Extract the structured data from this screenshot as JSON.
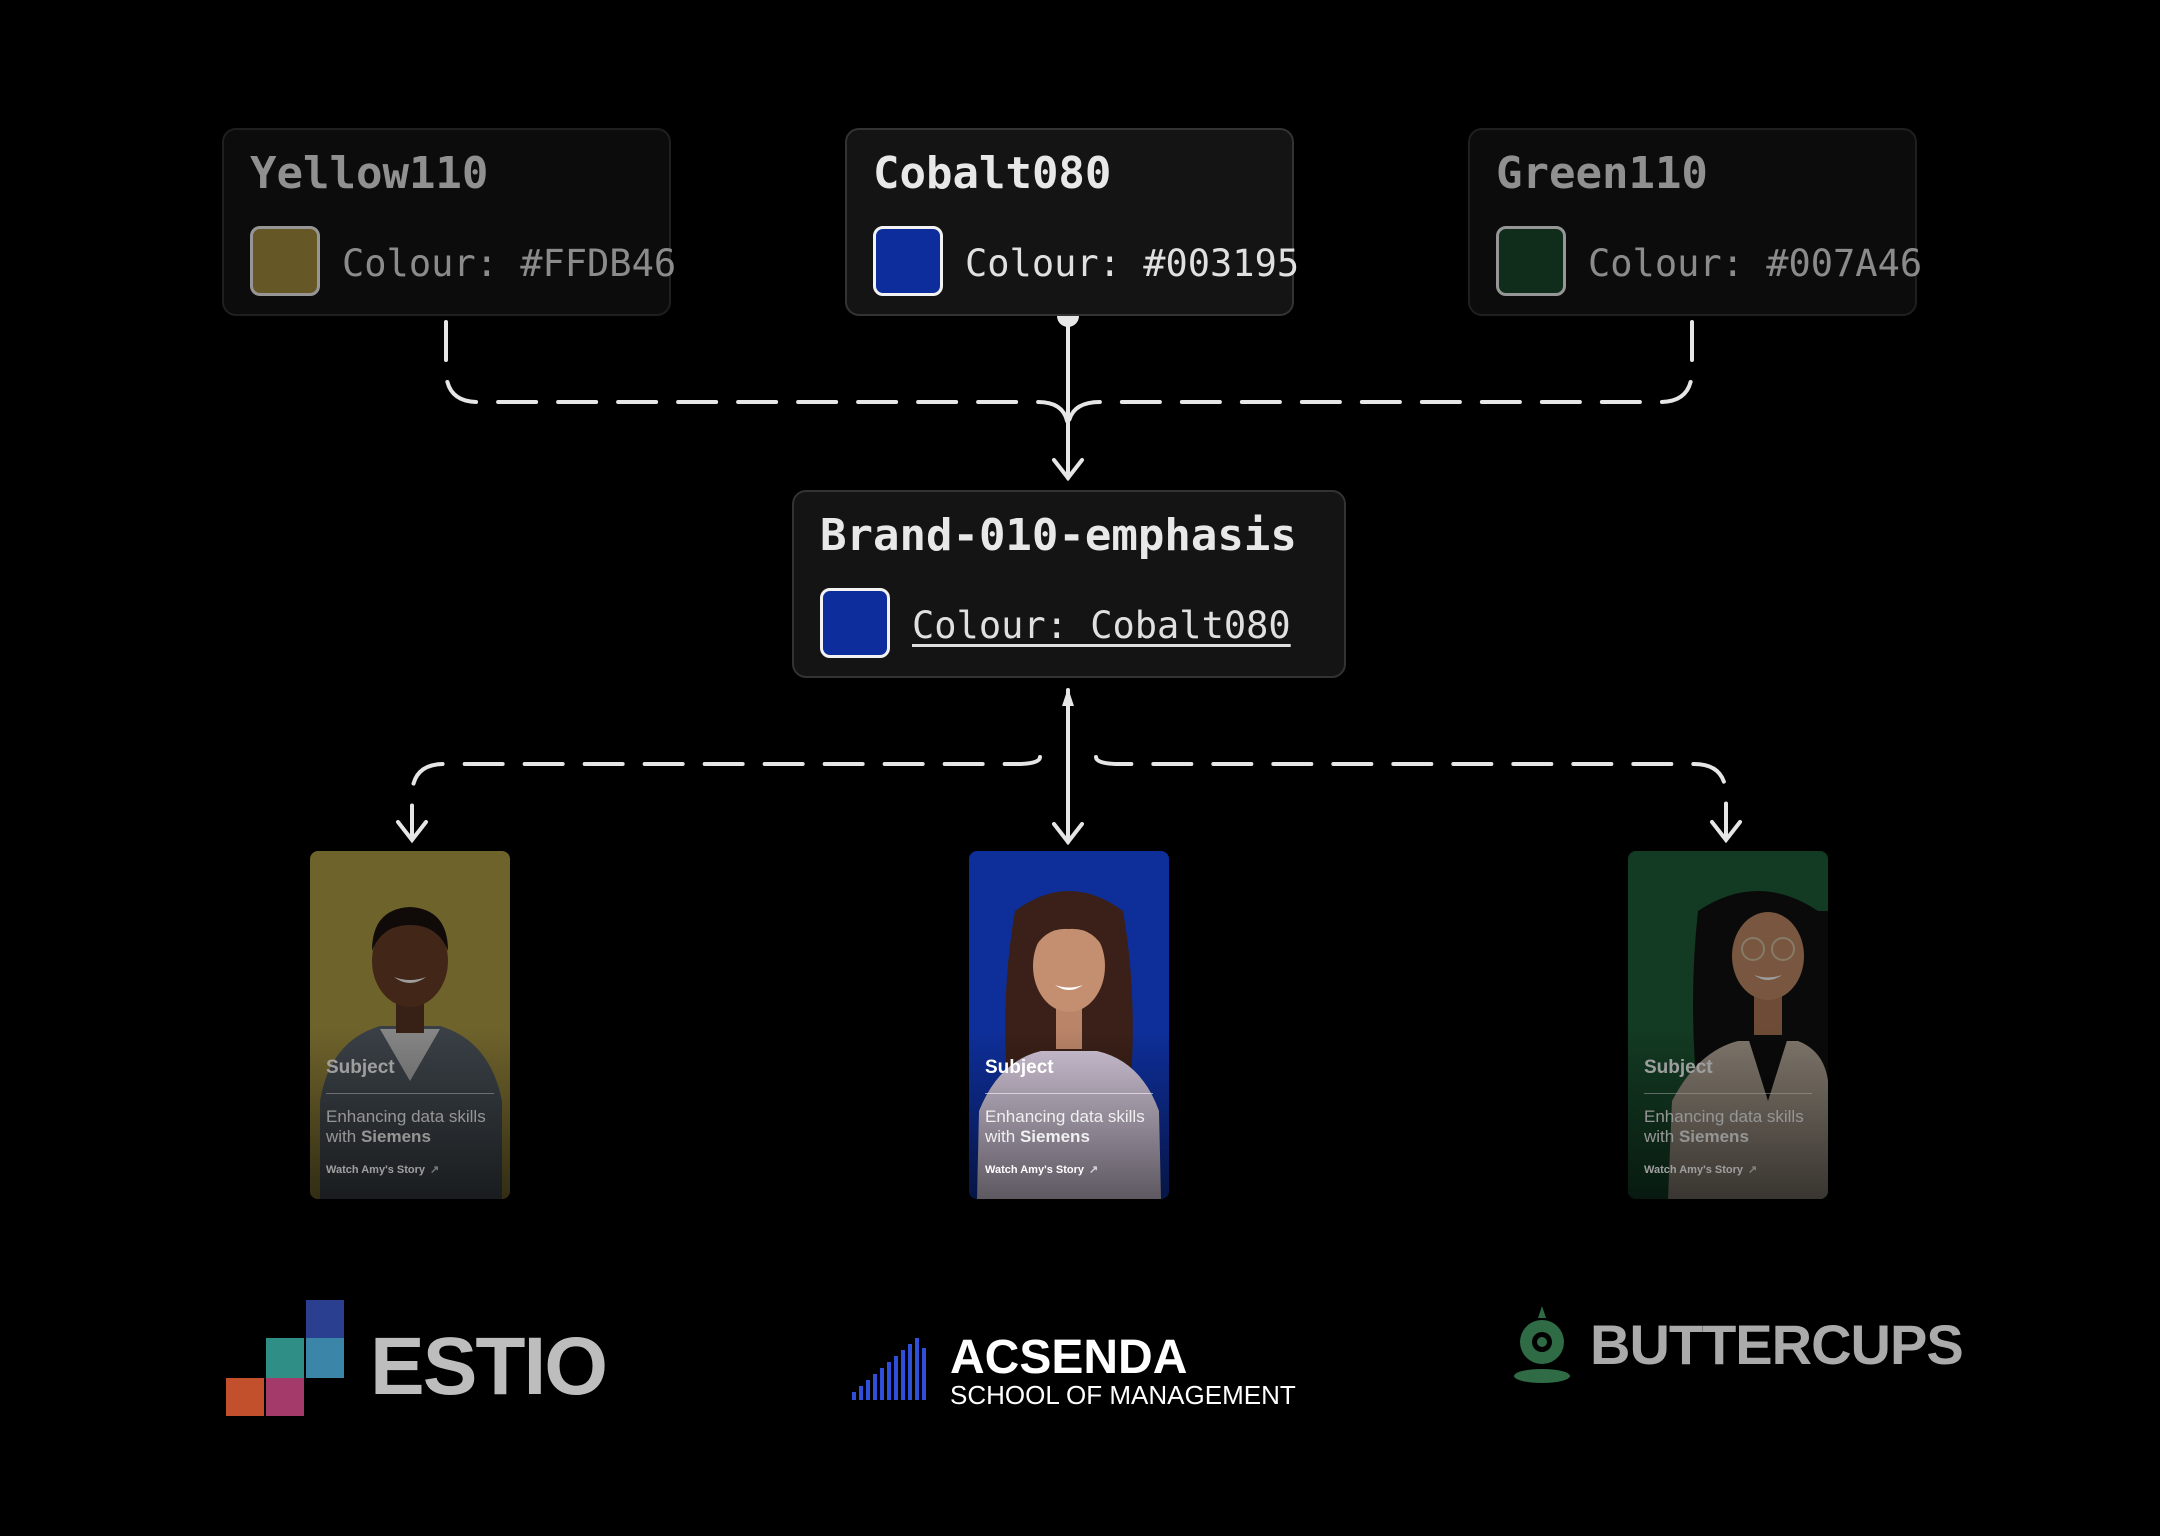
{
  "tokens": [
    {
      "name": "Yellow110",
      "colour_label": "Colour: #FFDB46",
      "swatch": "#a38f3e"
    },
    {
      "name": "Cobalt080",
      "colour_label": "Colour: #003195",
      "swatch": "#0e2d9c"
    },
    {
      "name": "Green110",
      "colour_label": "Colour: #007A46",
      "swatch": "#1b4a2c"
    }
  ],
  "brand_token": {
    "name": "Brand-010-emphasis",
    "colour_label": "Colour: Cobalt080",
    "swatch": "#0e2d9c"
  },
  "cards": [
    {
      "bg": "#b3a047",
      "subject": "Subject",
      "desc_prefix": "Enhancing data skills with ",
      "desc_bold": "Siemens",
      "link": "Watch Amy's Story"
    },
    {
      "bg": "#0e2f9a",
      "subject": "Subject",
      "desc_prefix": "Enhancing data skills with ",
      "desc_bold": "Siemens",
      "link": "Watch Amy's Story"
    },
    {
      "bg": "#1f5e38",
      "subject": "Subject",
      "desc_prefix": "Enhancing data skills with ",
      "desc_bold": "Siemens",
      "link": "Watch Amy's Story"
    }
  ],
  "logos": {
    "estio": {
      "name": "ESTIO",
      "color": "#bdbdbd"
    },
    "acsenda": {
      "name": "ACSENDA",
      "sub": "SCHOOL OF MANAGEMENT",
      "color": "#ffffff",
      "accent": "#2f4fd8"
    },
    "buttercups": {
      "name": "BUTTERCUPS",
      "color": "#aaaaaa",
      "accent": "#2f6b45"
    }
  },
  "colors": {
    "connector": "#e6e6e6",
    "background": "#000000",
    "card_bg": "#141414"
  }
}
